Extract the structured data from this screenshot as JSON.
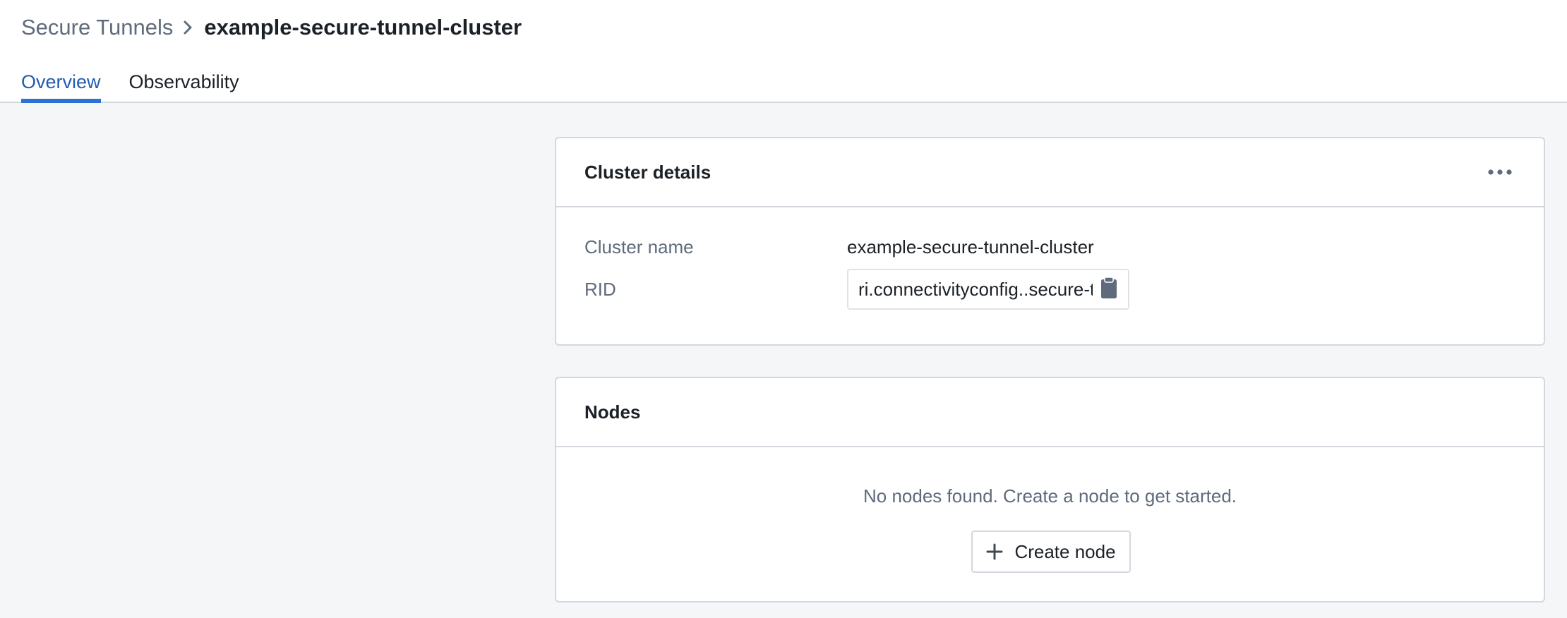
{
  "breadcrumb": {
    "parent": "Secure Tunnels",
    "current": "example-secure-tunnel-cluster"
  },
  "tabs": [
    {
      "label": "Overview",
      "active": true
    },
    {
      "label": "Observability",
      "active": false
    }
  ],
  "cluster_details": {
    "title": "Cluster details",
    "more_icon": "more-horizontal-icon",
    "fields": {
      "cluster_name_label": "Cluster name",
      "cluster_name_value": "example-secure-tunnel-cluster",
      "rid_label": "RID",
      "rid_value": "ri.connectivityconfig..secure-tunnel-cluster"
    },
    "copy_icon": "clipboard-icon"
  },
  "nodes": {
    "title": "Nodes",
    "empty_message": "No nodes found. Create a node to get started.",
    "create_button_label": "Create node",
    "create_button_icon": "plus-icon"
  },
  "colors": {
    "accent": "#2d72d2",
    "accent_text": "#215db0",
    "muted_text": "#5f6b7c",
    "border": "#d3d8de",
    "background": "#f5f6f8"
  }
}
